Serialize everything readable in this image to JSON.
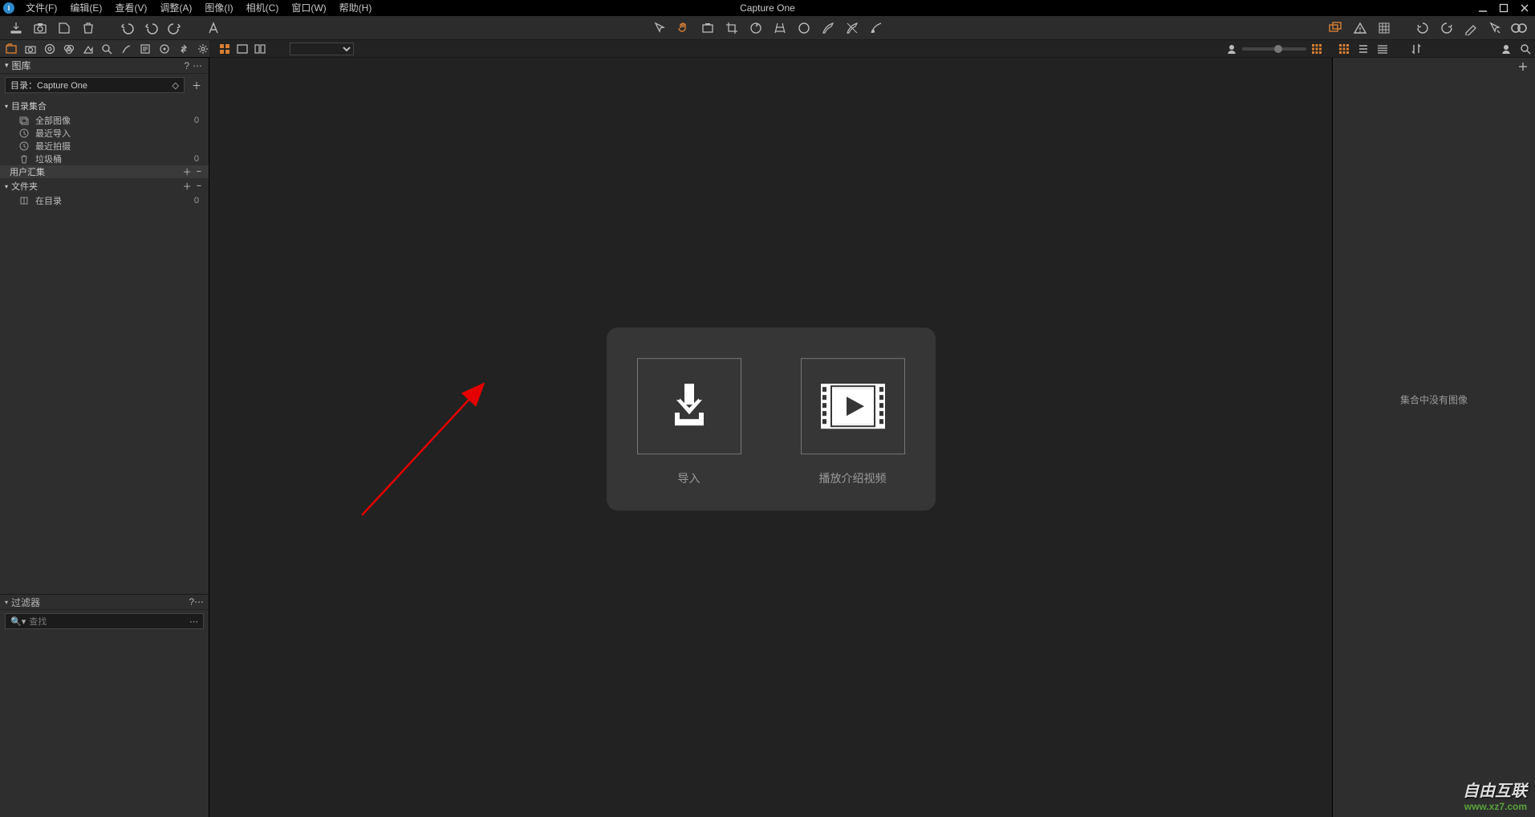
{
  "app": {
    "title": "Capture One"
  },
  "menubar": {
    "items": [
      "文件(F)",
      "编辑(E)",
      "查看(V)",
      "调整(A)",
      "图像(I)",
      "相机(C)",
      "窗口(W)",
      "帮助(H)"
    ]
  },
  "sidebar": {
    "panel_title": "图库",
    "catalog_prefix": "目录：",
    "catalog_name": "Capture One",
    "groups": {
      "collections_title": "目录集合",
      "user_collections_title": "用户汇集",
      "folders_title": "文件夹"
    },
    "items": {
      "all_images": {
        "label": "全部图像",
        "count": "0"
      },
      "recent_imports": {
        "label": "最近导入",
        "count": ""
      },
      "recent_captures": {
        "label": "最近拍摄",
        "count": ""
      },
      "trash": {
        "label": "垃圾桶",
        "count": "0"
      },
      "in_catalog": {
        "label": "在目录",
        "count": "0"
      }
    },
    "filter_panel_title": "过滤器",
    "search_placeholder": "查找"
  },
  "welcome": {
    "import_label": "导入",
    "play_intro_label": "播放介绍视频"
  },
  "browser": {
    "empty_text": "集合中没有图像"
  },
  "watermark": {
    "line1": "自由互联",
    "line2": "www.xz7.com"
  }
}
